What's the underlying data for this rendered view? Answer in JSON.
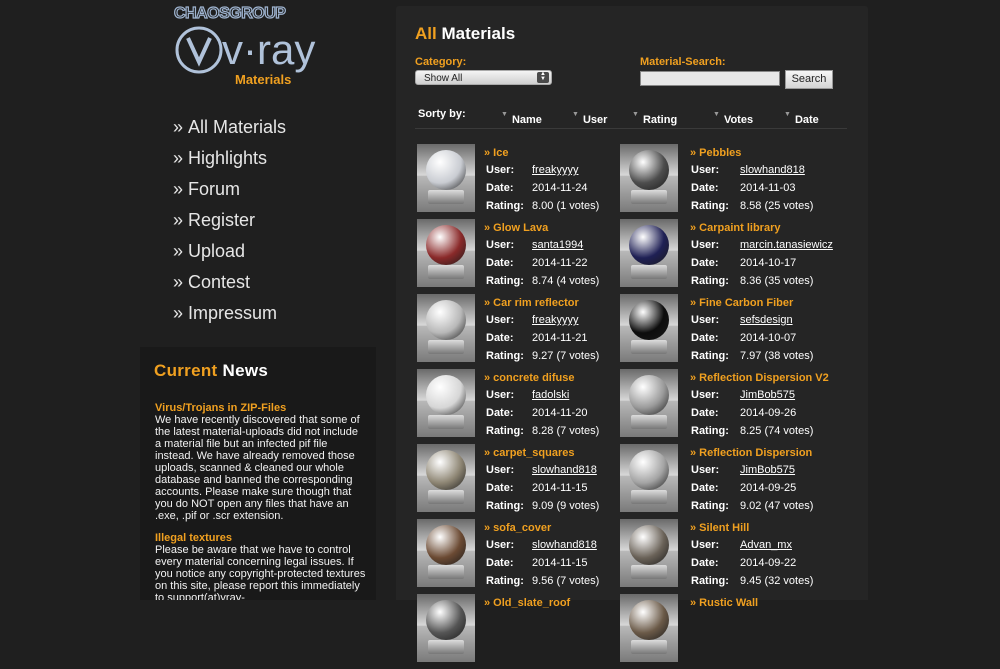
{
  "logo": {
    "company": "CHAOSGROUP",
    "brand": "v·ray",
    "sub": "Materials",
    "accent": "#f0a020"
  },
  "nav": [
    "All Materials",
    "Highlights",
    "Forum",
    "Register",
    "Upload",
    "Contest",
    "Impressum"
  ],
  "nav_prefix": "»",
  "news": {
    "heading_hl": "Current",
    "heading": " News",
    "items": [
      {
        "title": "Virus/Trojans in ZIP-Files",
        "body": "We have recently discovered that some of the latest material-uploads did not include a material file but an infected pif file instead. We have already removed those uploads, scanned & cleaned our whole database and banned the corresponding accounts. Please make sure though that you do NOT open any files that have an .exe, .pif or .scr extension."
      },
      {
        "title": "Illegal textures",
        "body": "Please be aware that we have to control every material concerning legal issues. If you notice any copyright-protected textures on this site, please report this immediately to support(at)vray-"
      }
    ]
  },
  "main": {
    "title_hl": "All",
    "title": " Materials",
    "category_label": "Category:",
    "category_value": "Show All",
    "search_label": "Material-Search:",
    "search_value": "",
    "search_button": "Search",
    "sort_label": "Sorty by:",
    "sort_keys": [
      "Name",
      "User",
      "Rating",
      "Votes",
      "Date"
    ]
  },
  "labels": {
    "user": "User:",
    "date": "Date:",
    "rating": "Rating:"
  },
  "materials": [
    {
      "name": "» Ice",
      "user": "freakyyyy",
      "date": "2014-11-24",
      "rating": "8.00 (1 votes)",
      "color": "#c9ccd2"
    },
    {
      "name": "» Pebbles",
      "user": "slowhand818",
      "date": "2014-11-03",
      "rating": "8.58 (25 votes)",
      "color": "#4d4d4d"
    },
    {
      "name": "» Glow Lava",
      "user": "santa1994",
      "date": "2014-11-22",
      "rating": "8.74 (4 votes)",
      "color": "#8a2a2a"
    },
    {
      "name": "» Carpaint library",
      "user": "marcin.tanasiewicz",
      "date": "2014-10-17",
      "rating": "8.36 (35 votes)",
      "color": "#1f2055"
    },
    {
      "name": "» Car rim reflector",
      "user": "freakyyyy",
      "date": "2014-11-21",
      "rating": "9.27 (7 votes)",
      "color": "#b8b8b8"
    },
    {
      "name": "» Fine Carbon Fiber",
      "user": "sefsdesign",
      "date": "2014-10-07",
      "rating": "7.97 (38 votes)",
      "color": "#0d0d0d"
    },
    {
      "name": "» concrete difuse",
      "user": "fadolski",
      "date": "2014-11-20",
      "rating": "8.28 (7 votes)",
      "color": "#d6d6d6"
    },
    {
      "name": "» Reflection Dispersion V2",
      "user": "JimBob575",
      "date": "2014-09-26",
      "rating": "8.25 (74 votes)",
      "color": "#9a9a9a"
    },
    {
      "name": "» carpet_squares",
      "user": "slowhand818",
      "date": "2014-11-15",
      "rating": "9.09 (9 votes)",
      "color": "#8e8674"
    },
    {
      "name": "» Reflection Dispersion",
      "user": "JimBob575",
      "date": "2014-09-25",
      "rating": "9.02 (47 votes)",
      "color": "#a4a4a4"
    },
    {
      "name": "» sofa_cover",
      "user": "slowhand818",
      "date": "2014-11-15",
      "rating": "9.56 (7 votes)",
      "color": "#6b4a33"
    },
    {
      "name": "» Silent Hill",
      "user": "Advan_mx",
      "date": "2014-09-22",
      "rating": "9.45 (32 votes)",
      "color": "#6a6258"
    },
    {
      "name": "» Old_slate_roof",
      "user": "",
      "date": "",
      "rating": "",
      "color": "#555555"
    },
    {
      "name": "» Rustic Wall",
      "user": "",
      "date": "",
      "rating": "",
      "color": "#6b5a48"
    }
  ]
}
